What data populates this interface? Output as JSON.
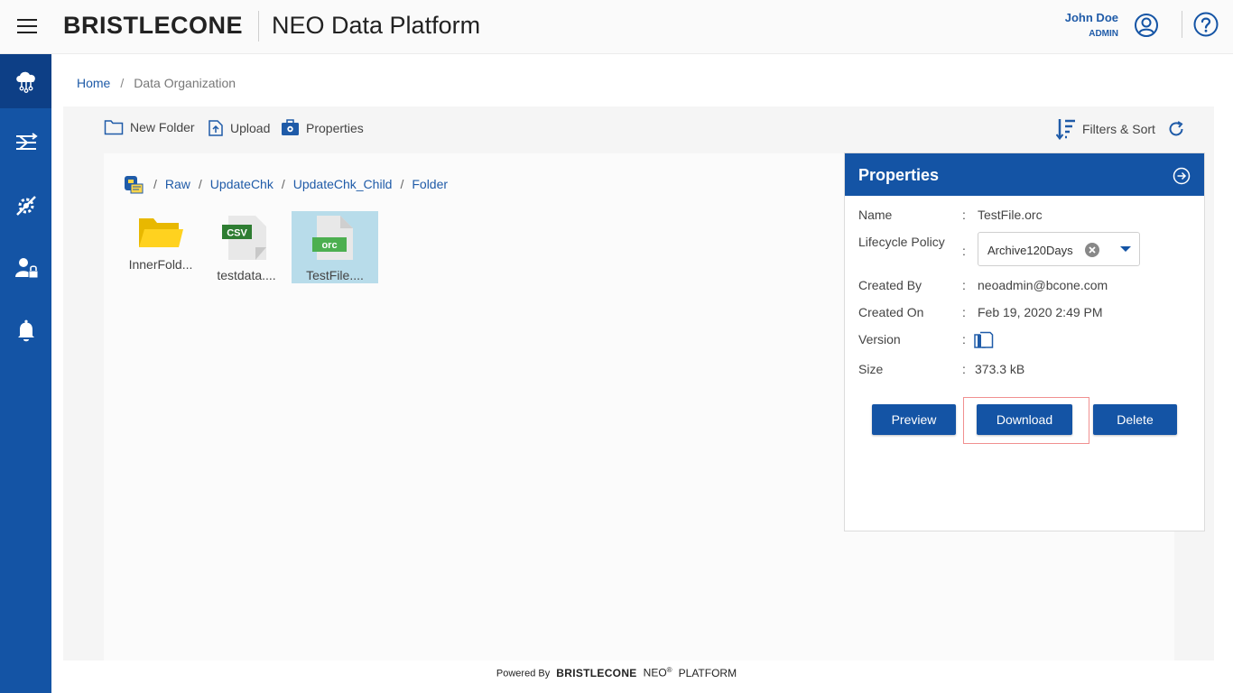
{
  "header": {
    "logo": "BRISTLECONE",
    "app_title": "NEO Data Platform",
    "user_name": "John Doe",
    "user_role": "ADMIN"
  },
  "sidebar": {
    "items": [
      {
        "icon": "cloud-data-icon",
        "active": true
      },
      {
        "icon": "pipeline-icon",
        "active": false
      },
      {
        "icon": "settings-tools-icon",
        "active": false
      },
      {
        "icon": "user-admin-icon",
        "active": false
      },
      {
        "icon": "bell-icon",
        "active": false
      }
    ]
  },
  "breadcrumb": {
    "home": "Home",
    "separator": "/",
    "current": "Data Organization"
  },
  "toolbar": {
    "new_folder": "New Folder",
    "upload": "Upload",
    "properties": "Properties",
    "filters_sort": "Filters & Sort"
  },
  "path": {
    "segments": [
      "Raw",
      "UpdateChk",
      "UpdateChk_Child",
      "Folder"
    ]
  },
  "files": [
    {
      "name": "InnerFold...",
      "type": "folder",
      "selected": false
    },
    {
      "name": "testdata....",
      "type": "csv",
      "badge": "CSV",
      "selected": false
    },
    {
      "name": "TestFile....",
      "type": "orc",
      "badge": "orc",
      "selected": true
    }
  ],
  "properties_panel": {
    "title": "Properties",
    "rows": {
      "name_label": "Name",
      "name_value": "TestFile.orc",
      "lifecycle_label": "Lifecycle Policy",
      "lifecycle_value": "Archive120Days",
      "created_by_label": "Created By",
      "created_by_value": "neoadmin@bcone.com",
      "created_on_label": "Created On",
      "created_on_value": "Feb 19, 2020 2:49 PM",
      "version_label": "Version",
      "size_label": "Size",
      "size_value": "373.3 kB",
      "colon": ":"
    },
    "buttons": {
      "preview": "Preview",
      "download": "Download",
      "delete": "Delete"
    }
  },
  "footer": {
    "powered_by": "Powered By",
    "brand": "BRISTLECONE",
    "neo": "NEO",
    "reg": "®",
    "platform": "PLATFORM"
  },
  "colors": {
    "primary": "#1454a5",
    "sidebar_active": "#0d3f86",
    "link": "#1f5ba8",
    "selection": "#b8dcea",
    "folder": "#f5c400",
    "csv_badge": "#2e7d32",
    "orc_badge": "#4caf50"
  }
}
